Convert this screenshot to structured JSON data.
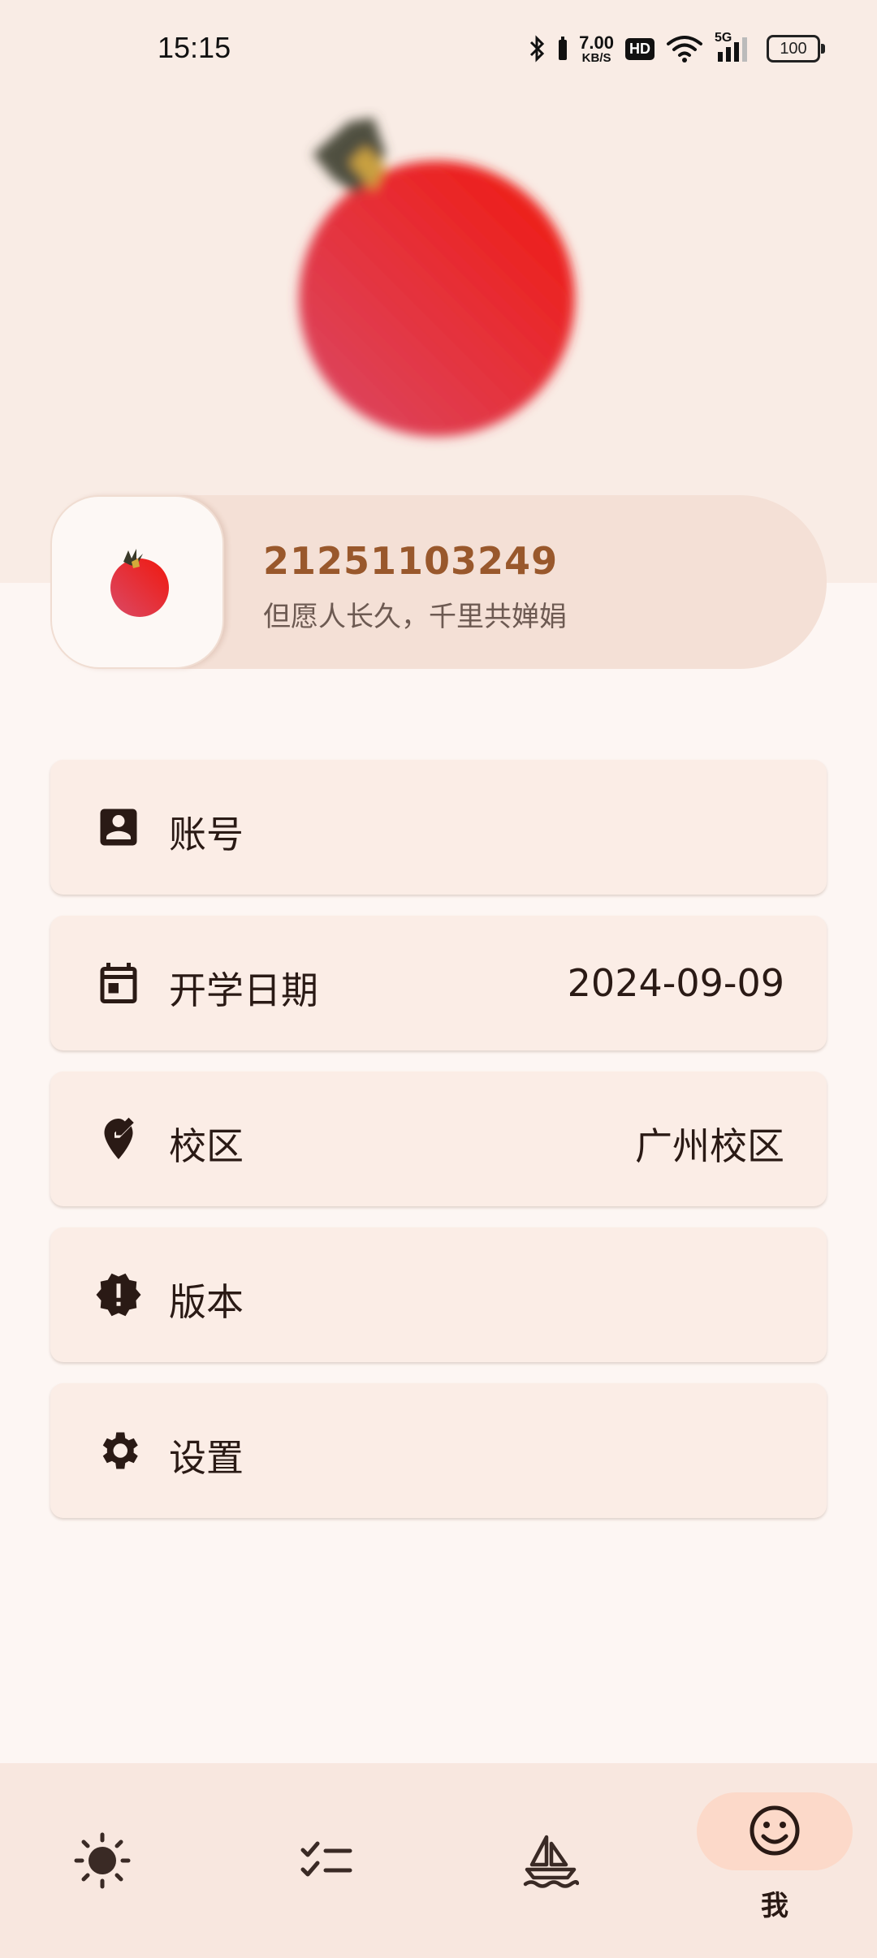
{
  "status_bar": {
    "time": "15:15",
    "net_speed_value": "7.00",
    "net_speed_unit": "KB/S",
    "hd_label": "HD",
    "network_label": "5G",
    "battery": "100"
  },
  "profile": {
    "user_id": "21251103249",
    "motto": "但愿人长久，千里共婵娟"
  },
  "menu": [
    {
      "label": "账号",
      "value": "",
      "icon": "account-box-icon"
    },
    {
      "label": "开学日期",
      "value": "2024-09-09",
      "icon": "calendar-icon"
    },
    {
      "label": "校区",
      "value": "广州校区",
      "icon": "location-edit-icon"
    },
    {
      "label": "版本",
      "value": "",
      "icon": "new-releases-icon"
    },
    {
      "label": "设置",
      "value": "",
      "icon": "gear-icon"
    }
  ],
  "bottom_nav": [
    {
      "icon": "sun-icon",
      "label": ""
    },
    {
      "icon": "checklist-icon",
      "label": ""
    },
    {
      "icon": "sailboat-icon",
      "label": ""
    },
    {
      "icon": "smiley-icon",
      "label": "我",
      "active": true
    }
  ],
  "colors": {
    "accent": "#99582c",
    "hero_bg": "#f9ece5",
    "page_bg": "#fdf6f3",
    "active_pill": "#fcd9c9",
    "tomato": "#e8384a"
  }
}
